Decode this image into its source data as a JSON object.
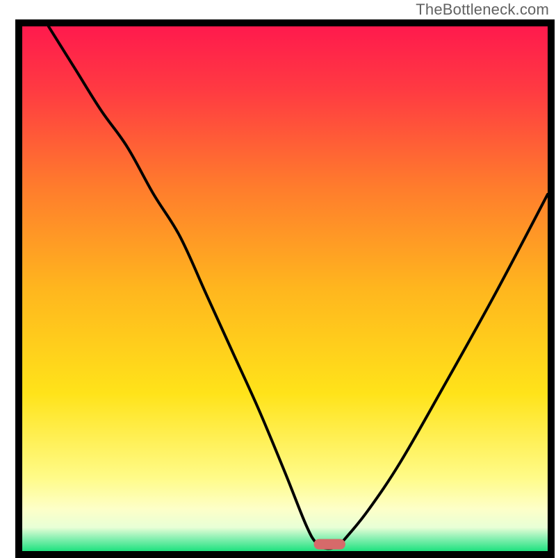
{
  "attribution": "TheBottleneck.com",
  "colors": {
    "frame": "#000000",
    "curve": "#000000",
    "marker": "#d66a6a",
    "gradient_stops": [
      {
        "offset": 0.0,
        "color": "#ff1a4d"
      },
      {
        "offset": 0.12,
        "color": "#ff3a42"
      },
      {
        "offset": 0.3,
        "color": "#ff7a2d"
      },
      {
        "offset": 0.5,
        "color": "#ffb61e"
      },
      {
        "offset": 0.7,
        "color": "#ffe31a"
      },
      {
        "offset": 0.86,
        "color": "#fffb88"
      },
      {
        "offset": 0.92,
        "color": "#fdffc8"
      },
      {
        "offset": 0.955,
        "color": "#e8ffd6"
      },
      {
        "offset": 0.975,
        "color": "#8cf0b3"
      },
      {
        "offset": 1.0,
        "color": "#1FE27F"
      }
    ]
  },
  "chart_data": {
    "type": "line",
    "title": "",
    "xlabel": "",
    "ylabel": "",
    "xlim": [
      0,
      100
    ],
    "ylim": [
      0,
      100
    ],
    "grid": false,
    "optimal_marker": {
      "x_center": 58.5,
      "width": 6,
      "y": 1.3
    },
    "series": [
      {
        "name": "bottleneck-curve",
        "x": [
          5,
          10,
          15,
          20,
          25,
          30,
          35,
          40,
          45,
          50,
          54,
          56,
          58,
          60,
          62,
          66,
          72,
          80,
          90,
          100
        ],
        "y": [
          100,
          92,
          84,
          77,
          68,
          60,
          49,
          38,
          27,
          15,
          5,
          1.5,
          0.5,
          1,
          3,
          8,
          17,
          31,
          49,
          68
        ]
      }
    ]
  }
}
